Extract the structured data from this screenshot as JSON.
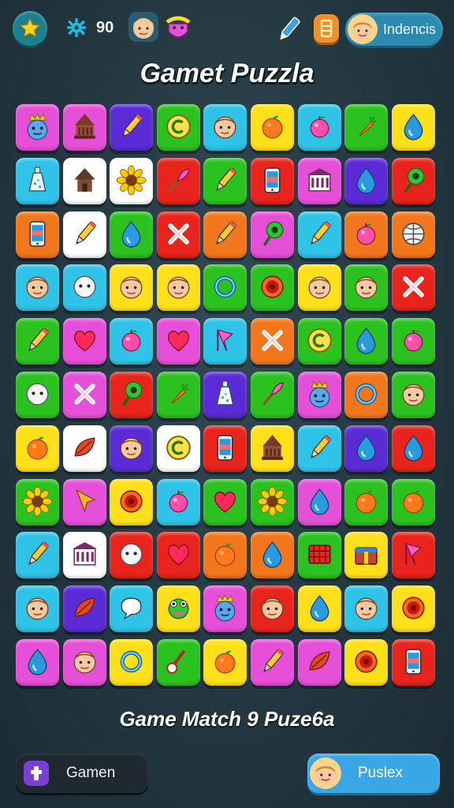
{
  "header": {
    "score": "90",
    "profile_name": "Indencis"
  },
  "title": "Gamet Puzzla",
  "subtitle": "Game Match 9 Puze6a",
  "footer": {
    "left_button_label": "Gamen",
    "right_button_label": "Puslex"
  },
  "board": {
    "columns": 9,
    "rows": 11,
    "tiles": [
      [
        "#e64fd8",
        "crown-face-icon"
      ],
      [
        "#e64fd8",
        "temple-icon"
      ],
      [
        "#5b2bd6",
        "pencil-icon"
      ],
      [
        "#2bc21f",
        "coin-c-icon"
      ],
      [
        "#2fc3e8",
        "face-icon"
      ],
      [
        "#ffe01a",
        "orange-icon"
      ],
      [
        "#2fc3e8",
        "apple-icon"
      ],
      [
        "#2bc21f",
        "carrot-icon"
      ],
      [
        "#ffe01a",
        "drop-icon"
      ],
      [
        "#2fc3e8",
        "bottle-icon"
      ],
      [
        "#ffffff",
        "hut-icon"
      ],
      [
        "#ffffff",
        "sunflower-icon"
      ],
      [
        "#e8241c",
        "brush-icon"
      ],
      [
        "#2bc21f",
        "pencil-icon"
      ],
      [
        "#e8241c",
        "phone-icon"
      ],
      [
        "#e64fd8",
        "building-icon"
      ],
      [
        "#5b2bd6",
        "drop-icon"
      ],
      [
        "#e8241c",
        "pin-icon"
      ],
      [
        "#f2771c",
        "phone-icon"
      ],
      [
        "#ffffff",
        "pencil-icon"
      ],
      [
        "#2bc21f",
        "drop-icon"
      ],
      [
        "#e8241c",
        "cross-icon"
      ],
      [
        "#f2771c",
        "pencil-icon"
      ],
      [
        "#e64fd8",
        "pin-icon"
      ],
      [
        "#2fc3e8",
        "pencil-icon"
      ],
      [
        "#f2771c",
        "apple-icon"
      ],
      [
        "#f2771c",
        "globe-icon"
      ],
      [
        "#2fc3e8",
        "face-icon"
      ],
      [
        "#2fc3e8",
        "ball-icon"
      ],
      [
        "#ffe01a",
        "face-icon"
      ],
      [
        "#ffe01a",
        "face-icon"
      ],
      [
        "#2bc21f",
        "ring-icon"
      ],
      [
        "#2bc21f",
        "target-icon"
      ],
      [
        "#ffe01a",
        "face-icon"
      ],
      [
        "#2bc21f",
        "face-icon"
      ],
      [
        "#e8241c",
        "cross-icon"
      ],
      [
        "#2bc21f",
        "pencil-icon"
      ],
      [
        "#e64fd8",
        "heart-icon"
      ],
      [
        "#2fc3e8",
        "apple-icon"
      ],
      [
        "#e64fd8",
        "heart-icon"
      ],
      [
        "#2fc3e8",
        "flag-icon"
      ],
      [
        "#f2771c",
        "cross-icon"
      ],
      [
        "#2bc21f",
        "coin-c-icon"
      ],
      [
        "#2bc21f",
        "drop-icon"
      ],
      [
        "#2bc21f",
        "apple-icon"
      ],
      [
        "#2bc21f",
        "ball-icon"
      ],
      [
        "#e64fd8",
        "cross-icon"
      ],
      [
        "#e8241c",
        "pin-icon"
      ],
      [
        "#2bc21f",
        "carrot-icon"
      ],
      [
        "#5b2bd6",
        "bottle-icon"
      ],
      [
        "#2bc21f",
        "brush-icon"
      ],
      [
        "#e64fd8",
        "crown-face-icon"
      ],
      [
        "#f2771c",
        "ring-icon"
      ],
      [
        "#2bc21f",
        "face-icon"
      ],
      [
        "#ffe01a",
        "orange-icon"
      ],
      [
        "#ffffff",
        "leaf-icon"
      ],
      [
        "#5b2bd6",
        "face-icon"
      ],
      [
        "#ffffff",
        "coin-c-icon"
      ],
      [
        "#e8241c",
        "phone-icon"
      ],
      [
        "#ffe01a",
        "temple-icon"
      ],
      [
        "#2fc3e8",
        "pencil-icon"
      ],
      [
        "#5b2bd6",
        "drop-icon"
      ],
      [
        "#e8241c",
        "drop-icon"
      ],
      [
        "#2bc21f",
        "sunflower-icon"
      ],
      [
        "#e64fd8",
        "arrow-icon"
      ],
      [
        "#ffe01a",
        "target-icon"
      ],
      [
        "#2fc3e8",
        "apple-icon"
      ],
      [
        "#2bc21f",
        "heart-icon"
      ],
      [
        "#2bc21f",
        "sunflower-icon"
      ],
      [
        "#e64fd8",
        "drop-icon"
      ],
      [
        "#2bc21f",
        "orange-icon"
      ],
      [
        "#2bc21f",
        "orange-icon"
      ],
      [
        "#2fc3e8",
        "pencil-icon"
      ],
      [
        "#ffffff",
        "building-icon"
      ],
      [
        "#e8241c",
        "ball-icon"
      ],
      [
        "#e8241c",
        "heart-icon"
      ],
      [
        "#f2771c",
        "orange-icon"
      ],
      [
        "#f2771c",
        "drop-icon"
      ],
      [
        "#2bc21f",
        "grid-icon"
      ],
      [
        "#ffe01a",
        "chest-icon"
      ],
      [
        "#e8241c",
        "flag-icon"
      ],
      [
        "#2fc3e8",
        "face-icon"
      ],
      [
        "#5b2bd6",
        "leaf-icon"
      ],
      [
        "#2fc3e8",
        "bubble-icon"
      ],
      [
        "#ffe01a",
        "frog-icon"
      ],
      [
        "#e64fd8",
        "crown-face-icon"
      ],
      [
        "#e8241c",
        "face-icon"
      ],
      [
        "#ffe01a",
        "drop-icon"
      ],
      [
        "#2fc3e8",
        "face-icon"
      ],
      [
        "#ffe01a",
        "target-icon"
      ],
      [
        "#e64fd8",
        "drop-icon"
      ],
      [
        "#e64fd8",
        "face-icon"
      ],
      [
        "#ffe01a",
        "ring-icon"
      ],
      [
        "#2bc21f",
        "thermometer-icon"
      ],
      [
        "#ffe01a",
        "orange-icon"
      ],
      [
        "#e64fd8",
        "pencil-icon"
      ],
      [
        "#e64fd8",
        "leaf-icon"
      ],
      [
        "#ffe01a",
        "target-icon"
      ],
      [
        "#e8241c",
        "phone-icon"
      ]
    ]
  }
}
